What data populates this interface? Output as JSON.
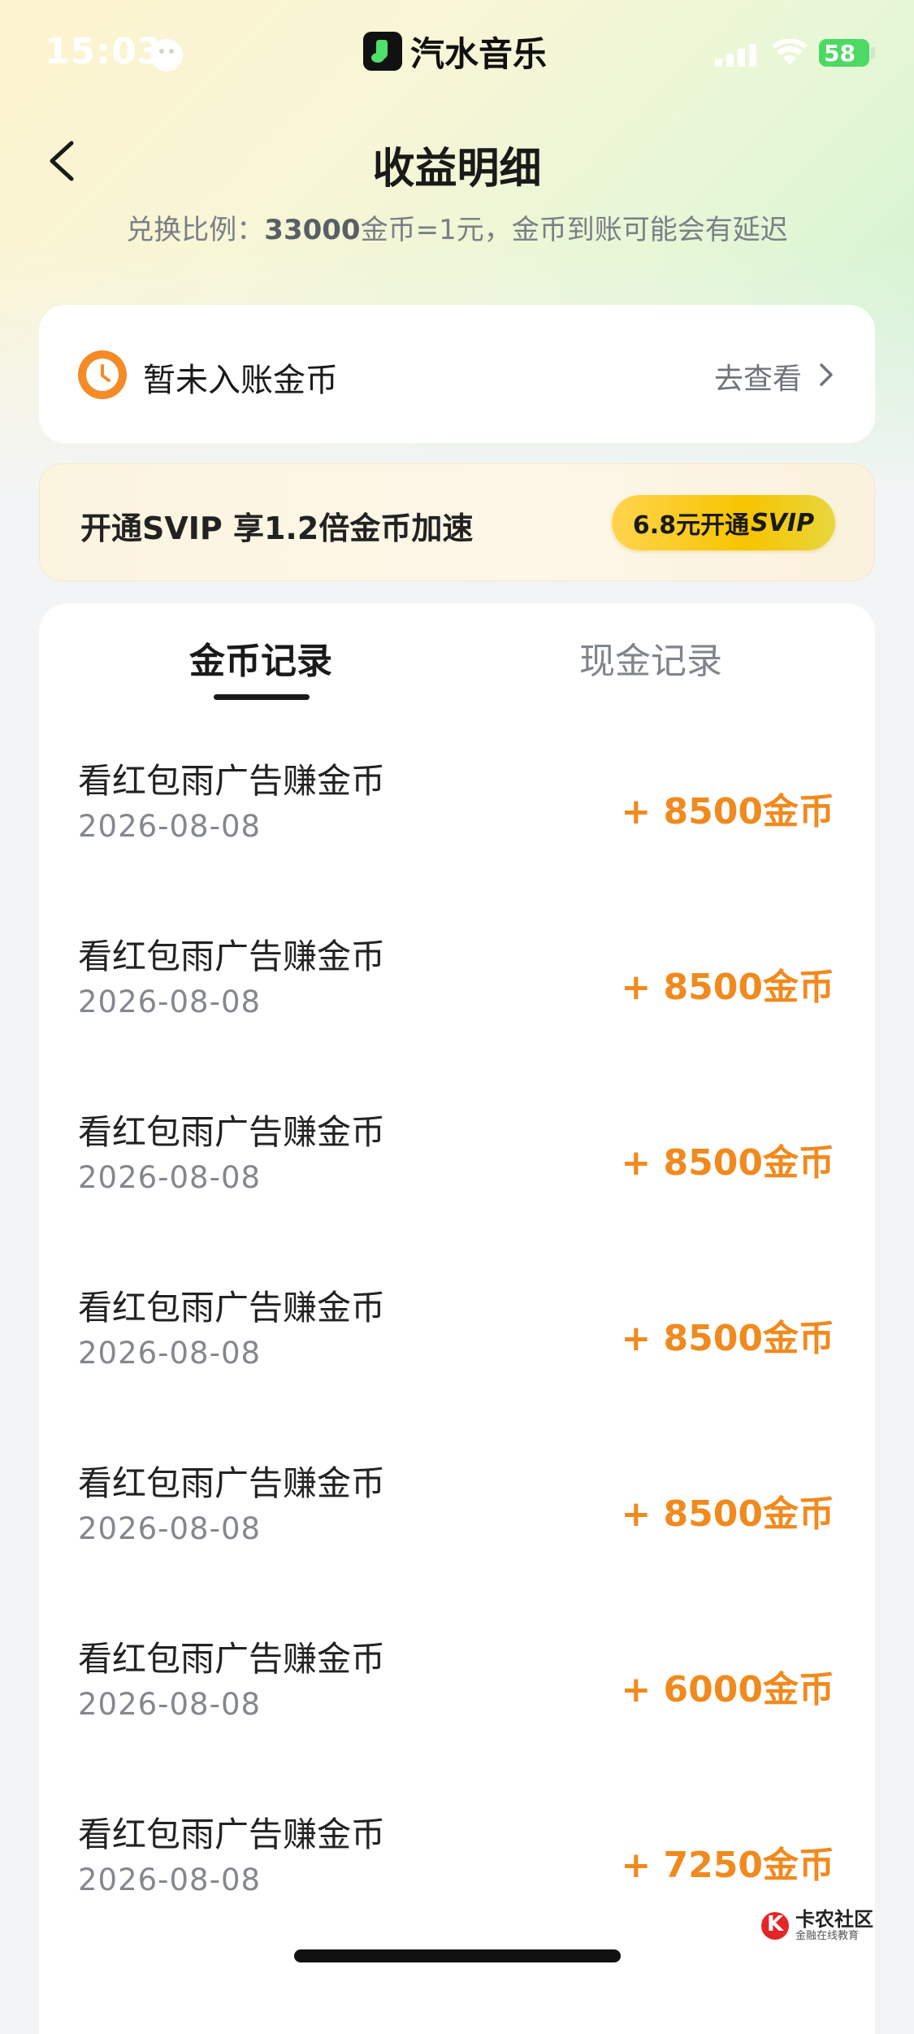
{
  "status_bar": {
    "time": "15:03",
    "app_name": "汽水音乐",
    "battery": "58"
  },
  "header": {
    "title": "收益明细",
    "subtitle_prefix": "兑换比例：",
    "subtitle_ratio": "33000",
    "subtitle_suffix": "金币=1元，金币到账可能会有延迟"
  },
  "pending": {
    "label": "暂未入账金币",
    "link": "去查看"
  },
  "svip": {
    "text": "开通SVIP 享1.2倍金币加速",
    "button_prefix": "6.8元开通",
    "button_brand": "SVIP"
  },
  "tabs": [
    {
      "label": "金币记录",
      "active": true
    },
    {
      "label": "现金记录",
      "active": false
    }
  ],
  "records": [
    {
      "title": "看红包雨广告赚金币",
      "date": "2026-08-08",
      "amount": "+ 8500金币"
    },
    {
      "title": "看红包雨广告赚金币",
      "date": "2026-08-08",
      "amount": "+ 8500金币"
    },
    {
      "title": "看红包雨广告赚金币",
      "date": "2026-08-08",
      "amount": "+ 8500金币"
    },
    {
      "title": "看红包雨广告赚金币",
      "date": "2026-08-08",
      "amount": "+ 8500金币"
    },
    {
      "title": "看红包雨广告赚金币",
      "date": "2026-08-08",
      "amount": "+ 8500金币"
    },
    {
      "title": "看红包雨广告赚金币",
      "date": "2026-08-08",
      "amount": "+ 6000金币"
    },
    {
      "title": "看红包雨广告赚金币",
      "date": "2026-08-08",
      "amount": "+ 7250金币"
    }
  ],
  "watermark": {
    "main": "卡农社区",
    "sub": "金融在线教育"
  },
  "colors": {
    "accent_orange": "#f08a1e",
    "svip_gold": "#f7c400",
    "clock_orange": "#f58b27"
  }
}
